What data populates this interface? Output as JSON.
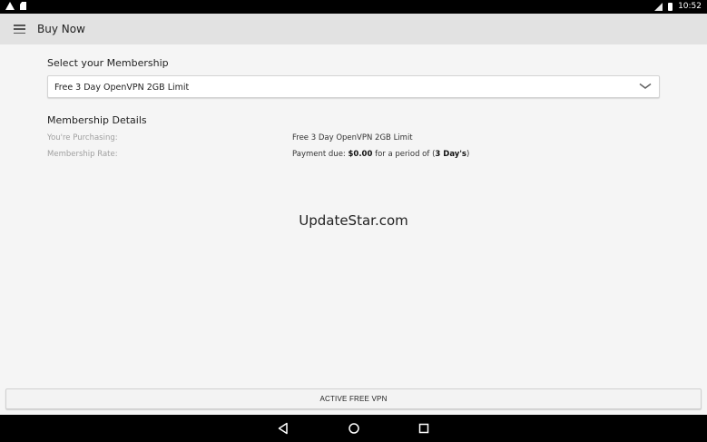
{
  "status_bar": {
    "time": "10:52",
    "icons_left": [
      "warning-icon",
      "sd-card-icon"
    ],
    "icons_right": [
      "signal-icon",
      "battery-icon"
    ]
  },
  "app_bar": {
    "title": "Buy Now",
    "menu_icon": "hamburger-menu-icon"
  },
  "membership": {
    "label": "Select your Membership",
    "selected": "Free 3 Day OpenVPN 2GB Limit"
  },
  "details": {
    "heading": "Membership Details",
    "purchasing_label": "You're Purchasing:",
    "purchasing_value": "Free 3 Day OpenVPN 2GB Limit",
    "rate_label": "Membership Rate:",
    "rate_prefix": "Payment due: ",
    "rate_amount": "$0.00",
    "rate_middle": " for a period of (",
    "rate_period": "3 Day's",
    "rate_suffix": ")"
  },
  "watermark": "UpdateStar.com",
  "action_button": "ACTIVE FREE VPN",
  "nav_bar": {
    "back": "back-icon",
    "home": "home-icon",
    "recents": "recents-icon"
  }
}
